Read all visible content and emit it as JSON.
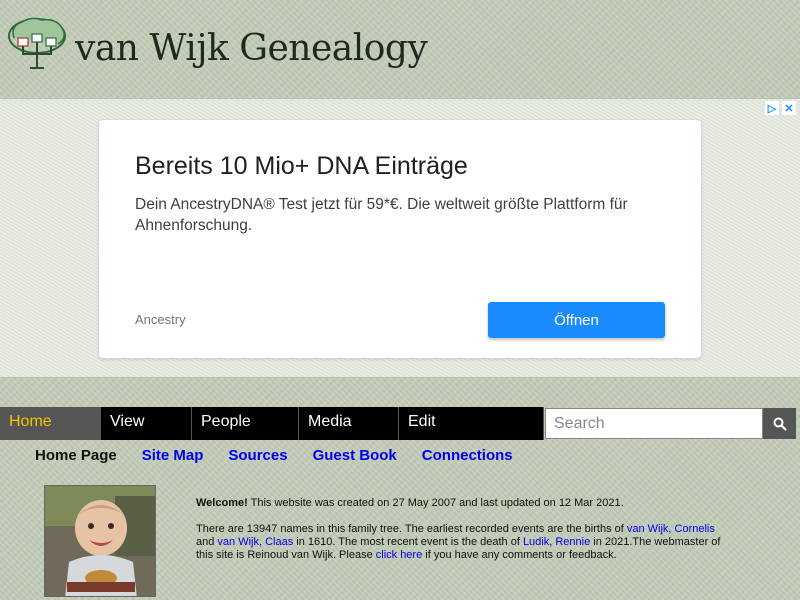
{
  "header": {
    "title": "van Wijk Genealogy",
    "logo_icon": "family-tree-icon"
  },
  "ad": {
    "corner_icons": [
      "adchoices-icon",
      "close-icon"
    ],
    "headline": "Bereits 10 Mio+ DNA Einträge",
    "description": "Dein AncestryDNA® Test jetzt für 59*€. Die weltweit größte Plattform für Ahnenforschung.",
    "brand": "Ancestry",
    "button_label": "Öffnen",
    "button_color": "#1a8cff"
  },
  "menu": {
    "items": [
      {
        "label": "Home",
        "active": true
      },
      {
        "label": "View"
      },
      {
        "label": "People"
      },
      {
        "label": "Media"
      },
      {
        "label": "Edit"
      }
    ],
    "active_color": "#f5c400"
  },
  "search": {
    "placeholder": "Search",
    "icon": "search-icon"
  },
  "subnav": {
    "current": "Home Page",
    "links": [
      "Site Map",
      "Sources",
      "Guest Book",
      "Connections"
    ]
  },
  "intro": {
    "welcome_bold": "Welcome!",
    "welcome_text": " This website was created on 27 May 2007 and last updated on 12 Mar 2021.",
    "p2_a": "There are 13947 names in this family tree. The earliest recorded events are the births of ",
    "link_cornelis": "van Wijk, Cornelis",
    "p2_b": " and ",
    "link_claas": "van Wijk, Claas",
    "p2_c": " in 1610. The most recent event is the death of ",
    "link_rennie": "Ludik, Rennie",
    "p2_d": " in 2021.The webmaster of this site is Reinoud van Wijk. Please ",
    "link_click": "click here",
    "p2_e": " if you have any comments or feedback."
  }
}
